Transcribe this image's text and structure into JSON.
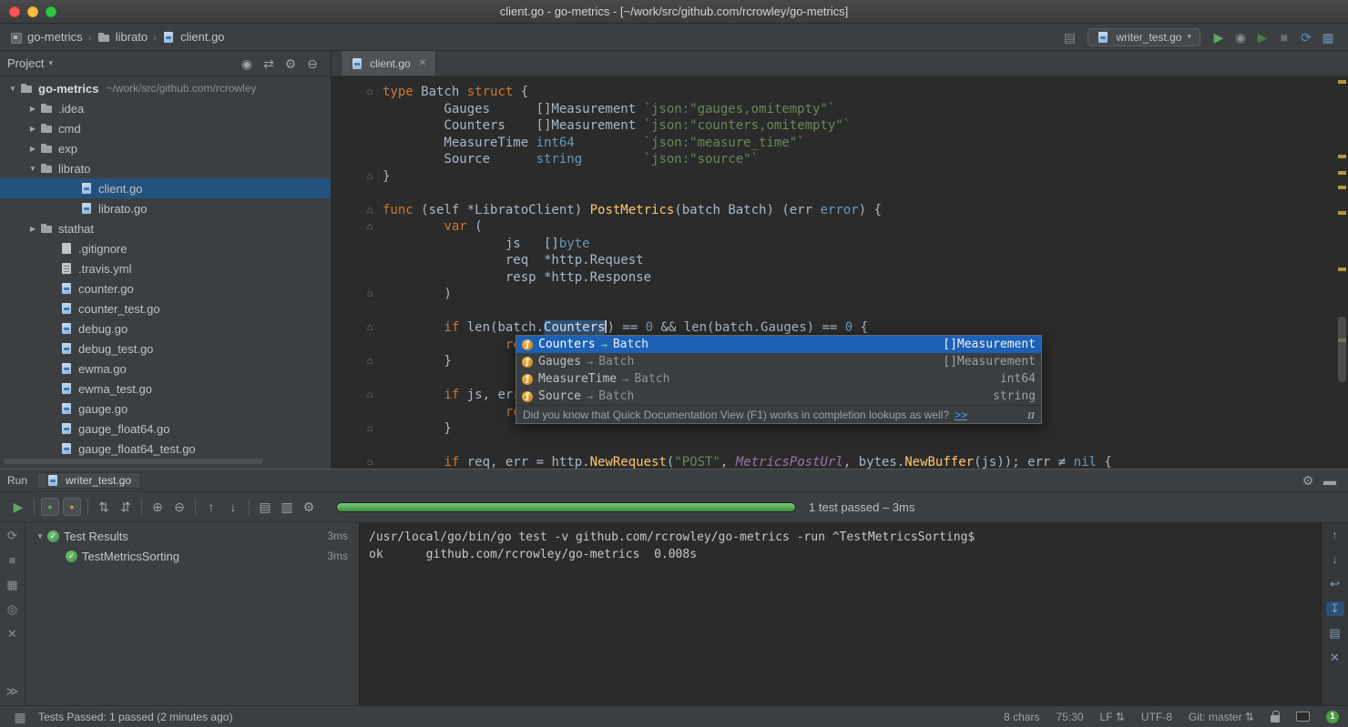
{
  "colors": {
    "panel_bg": "#3c3f41",
    "editor_bg": "#2b2b2b",
    "tree_selection": "#24527e",
    "completion_selection": "#1d61b5",
    "keyword_orange": "#cc7832",
    "string_green": "#6a8759",
    "type_blue": "#6897bb",
    "function_yellow": "#ffc66d",
    "run_green": "#5fa865",
    "progress_green": "#4f9f53",
    "warning_stripe": "#b89b3e"
  },
  "titlebar": {
    "title": "client.go - go-metrics - [~/work/src/github.com/rcrowley/go-metrics]"
  },
  "navbar": {
    "crumb_separator": "›",
    "breadcrumbs": [
      {
        "label": "go-metrics",
        "icon": "project"
      },
      {
        "label": "librato",
        "icon": "folder"
      },
      {
        "label": "client.go",
        "icon": "gofile"
      }
    ],
    "pre_actions": [
      {
        "n": "run-dashboard-icon",
        "g": "▤",
        "c": "#7f8b99"
      }
    ],
    "run_config": {
      "label": "writer_test.go",
      "chevron": "▾"
    },
    "actions": [
      {
        "n": "run-icon",
        "g": "▶",
        "c": "#5fa865"
      },
      {
        "n": "coverage-icon",
        "g": "◉",
        "c": "#8a8d8f"
      },
      {
        "n": "run-with-coverage-icon",
        "g": "▶",
        "c": "#49784d"
      },
      {
        "n": "stop-icon",
        "g": "■",
        "c": "#6b6e70"
      },
      {
        "n": "rerun-icon",
        "g": "⟳",
        "c": "#4e8fc4"
      },
      {
        "n": "editor-layout-icon",
        "g": "▦",
        "c": "#6c8cab"
      }
    ]
  },
  "project_panel": {
    "header": {
      "title": "Project",
      "chevron": "▾",
      "actions": [
        {
          "n": "locate-file-icon",
          "g": "◉",
          "c": "#9da2a8"
        },
        {
          "n": "scroll-from-source-icon",
          "g": "⇄",
          "c": "#9da2a8"
        },
        {
          "n": "settings-gear-icon",
          "g": "⚙",
          "c": "#9da2a8"
        },
        {
          "n": "collapse-all-icon",
          "g": "⊖",
          "c": "#9da2a8"
        }
      ]
    },
    "arrows": {
      "open": "▼",
      "closed": "▶"
    },
    "tree": [
      {
        "label": "go-metrics",
        "suffix": "~/work/src/github.com/rcrowley",
        "icon": "folder",
        "expand": "open",
        "indent": 0,
        "bold": true
      },
      {
        "label": ".idea",
        "icon": "folder",
        "expand": "closed",
        "indent": 1
      },
      {
        "label": "cmd",
        "icon": "folder",
        "expand": "closed",
        "indent": 1
      },
      {
        "label": "exp",
        "icon": "folder",
        "expand": "closed",
        "indent": 1
      },
      {
        "label": "librato",
        "icon": "folder",
        "expand": "open",
        "indent": 1
      },
      {
        "label": "client.go",
        "icon": "gofile",
        "indent": 3,
        "selected": true
      },
      {
        "label": "librato.go",
        "icon": "gofile",
        "indent": 3
      },
      {
        "label": "stathat",
        "icon": "folder",
        "expand": "closed",
        "indent": 1
      },
      {
        "label": ".gitignore",
        "icon": "file",
        "indent": 2
      },
      {
        "label": ".travis.yml",
        "icon": "yml",
        "indent": 2
      },
      {
        "label": "counter.go",
        "icon": "gofile",
        "indent": 2
      },
      {
        "label": "counter_test.go",
        "icon": "gofile",
        "indent": 2
      },
      {
        "label": "debug.go",
        "icon": "gofile",
        "indent": 2
      },
      {
        "label": "debug_test.go",
        "icon": "gofile",
        "indent": 2
      },
      {
        "label": "ewma.go",
        "icon": "gofile",
        "indent": 2
      },
      {
        "label": "ewma_test.go",
        "icon": "gofile",
        "indent": 2
      },
      {
        "label": "gauge.go",
        "icon": "gofile",
        "indent": 2
      },
      {
        "label": "gauge_float64.go",
        "icon": "gofile",
        "indent": 2
      },
      {
        "label": "gauge_float64_test.go",
        "icon": "gofile",
        "indent": 2
      }
    ]
  },
  "editor": {
    "tab": {
      "label": "client.go",
      "close_glyph": "✕"
    },
    "gutter_glyph": "⌂",
    "gutter_marks": [
      0,
      5,
      7,
      8,
      12,
      14,
      16,
      18,
      20,
      22
    ],
    "stripe_marks": [
      4,
      86,
      104,
      120,
      148,
      210,
      288
    ],
    "lines": [
      [
        [
          "k",
          "type"
        ],
        [
          "p",
          " Batch "
        ],
        [
          "k",
          "struct"
        ],
        [
          "p",
          " {"
        ]
      ],
      [
        [
          "p",
          "        Gauges      []Measurement "
        ],
        [
          "s",
          "`json:\"gauges,omitempty\"`"
        ]
      ],
      [
        [
          "p",
          "        Counters    []Measurement "
        ],
        [
          "s",
          "`json:\"counters,omitempty\"`"
        ]
      ],
      [
        [
          "p",
          "        MeasureTime "
        ],
        [
          "t",
          "int64"
        ],
        [
          "p",
          "         "
        ],
        [
          "s",
          "`json:\"measure_time\"`"
        ]
      ],
      [
        [
          "p",
          "        Source      "
        ],
        [
          "t",
          "string"
        ],
        [
          "p",
          "        "
        ],
        [
          "s",
          "`json:\"source\"`"
        ]
      ],
      [
        [
          "p",
          "}"
        ]
      ],
      [],
      [
        [
          "k",
          "func"
        ],
        [
          "p",
          " (self *LibratoClient) "
        ],
        [
          "f",
          "PostMetrics"
        ],
        [
          "p",
          "(batch Batch) (err "
        ],
        [
          "t",
          "error"
        ],
        [
          "p",
          ") {"
        ]
      ],
      [
        [
          "p",
          "        "
        ],
        [
          "k",
          "var"
        ],
        [
          "p",
          " ("
        ]
      ],
      [
        [
          "p",
          "                js   []"
        ],
        [
          "t",
          "byte"
        ]
      ],
      [
        [
          "p",
          "                req  *http.Request"
        ]
      ],
      [
        [
          "p",
          "                resp *http.Response"
        ]
      ],
      [
        [
          "p",
          "        )"
        ]
      ],
      [],
      [
        [
          "p",
          "        "
        ],
        [
          "k",
          "if"
        ],
        [
          "p",
          " len(batch."
        ],
        [
          "hl",
          "Counters"
        ],
        [
          "caret",
          ""
        ],
        [
          "p",
          ") == "
        ],
        [
          "n",
          "0"
        ],
        [
          "p",
          " && len(batch.Gauges) == "
        ],
        [
          "n",
          "0"
        ],
        [
          "p",
          " {"
        ]
      ],
      [
        [
          "p",
          "                "
        ],
        [
          "k",
          "re"
        ]
      ],
      [
        [
          "p",
          "        }"
        ]
      ],
      [],
      [
        [
          "p",
          "        "
        ],
        [
          "k",
          "if"
        ],
        [
          "p",
          " js, err"
        ]
      ],
      [
        [
          "p",
          "                "
        ],
        [
          "k",
          "re"
        ]
      ],
      [
        [
          "p",
          "        }"
        ]
      ],
      [],
      [
        [
          "p",
          "        "
        ],
        [
          "k",
          "if"
        ],
        [
          "p",
          " req, err = http."
        ],
        [
          "f",
          "NewRequest"
        ],
        [
          "p",
          "("
        ],
        [
          "s",
          "\"POST\""
        ],
        [
          "p",
          ", "
        ],
        [
          "i",
          "MetricsPostUrl"
        ],
        [
          "p",
          ", bytes."
        ],
        [
          "f",
          "NewBuffer"
        ],
        [
          "p",
          "(js)); err ≠ "
        ],
        [
          "t",
          "nil"
        ],
        [
          "p",
          " {"
        ]
      ]
    ],
    "completion": {
      "icon_glyph": "ƒ",
      "arrow": "→",
      "items": [
        {
          "name": "Counters",
          "target": "Batch",
          "type": "[]Measurement",
          "selected": true
        },
        {
          "name": "Gauges",
          "target": "Batch",
          "type": "[]Measurement"
        },
        {
          "name": "MeasureTime",
          "target": "Batch",
          "type": "int64"
        },
        {
          "name": "Source",
          "target": "Batch",
          "type": "string"
        }
      ],
      "hint": "Did you know that Quick Documentation View (F1) works in completion lookups as well?",
      "hint_link": ">>",
      "hint_pi": "π"
    }
  },
  "run_panel": {
    "label": "Run",
    "tab": "writer_test.go",
    "header_actions": [
      {
        "n": "settings-gear-icon",
        "g": "⚙",
        "c": "#9da2a8"
      },
      {
        "n": "hide-panel-icon",
        "g": "▬",
        "c": "#9da2a8"
      }
    ],
    "toolbar": [
      {
        "n": "rerun-tests-icon",
        "g": "▶",
        "c": "#5fa865"
      },
      {
        "sep": true
      },
      {
        "n": "show-passed-icon",
        "g": "●",
        "c": "#57a85c",
        "box": true
      },
      {
        "n": "show-ignored-icon",
        "g": "●",
        "c": "#b7a14a",
        "box": true
      },
      {
        "sep": true
      },
      {
        "n": "sort-alphabetically-icon",
        "g": "⇅",
        "c": "#9da2a8"
      },
      {
        "n": "sort-by-duration-icon",
        "g": "⇵",
        "c": "#9da2a8"
      },
      {
        "sep": true
      },
      {
        "n": "expand-all-icon",
        "g": "⊕",
        "c": "#9da2a8"
      },
      {
        "n": "collapse-all-icon",
        "g": "⊖",
        "c": "#9da2a8"
      },
      {
        "sep": true
      },
      {
        "n": "previous-failed-test-icon",
        "g": "↑",
        "c": "#9da2a8"
      },
      {
        "n": "next-failed-test-icon",
        "g": "↓",
        "c": "#9da2a8"
      },
      {
        "sep": true
      },
      {
        "n": "test-history-icon",
        "g": "▤",
        "c": "#9da2a8"
      },
      {
        "n": "import-results-icon",
        "g": "▥",
        "c": "#9da2a8"
      },
      {
        "n": "settings-gear-icon",
        "g": "⚙",
        "c": "#9da2a8"
      }
    ],
    "left_strip": [
      {
        "n": "rerun-icon",
        "g": "⟳",
        "c": "#8a9399"
      },
      {
        "n": "stop-icon",
        "g": "■",
        "c": "#6b6e70"
      },
      {
        "n": "restore-layout-icon",
        "g": "▦",
        "c": "#8a9399"
      },
      {
        "n": "pin-tab-icon",
        "g": "◎",
        "c": "#8a9399"
      },
      {
        "n": "close-icon",
        "g": "✕",
        "c": "#8a9399"
      },
      {
        "n": "more-tool-windows-icon",
        "g": "≫",
        "c": "#8a9399"
      }
    ],
    "right_strip": [
      {
        "n": "scroll-to-top-icon",
        "g": "↑",
        "c": "#8a9399"
      },
      {
        "n": "scroll-to-bottom-icon",
        "g": "↓",
        "c": "#8a9399"
      },
      {
        "n": "soft-wrap-icon",
        "g": "↩"
      },
      {
        "n": "scroll-to-end-icon",
        "g": "↧",
        "sel": true
      },
      {
        "n": "print-icon",
        "g": "▤"
      },
      {
        "n": "clear-console-icon",
        "g": "✕"
      }
    ],
    "progress_percent": 100,
    "progress_text": "1 test passed – 3ms",
    "pass_glyph": "✓",
    "tree": [
      {
        "label": "Test Results",
        "time": "3ms",
        "indent": 0,
        "expanded": true
      },
      {
        "label": "TestMetricsSorting",
        "time": "3ms",
        "indent": 1
      }
    ],
    "console": [
      "/usr/local/go/bin/go test -v github.com/rcrowley/go-metrics -run ^TestMetricsSorting$",
      "ok      github.com/rcrowley/go-metrics  0.008s"
    ]
  },
  "statusbar": {
    "left_icon": {
      "n": "toolwindow-toggle-icon",
      "g": "▦",
      "c": "#8a9399"
    },
    "left": "Tests Passed: 1 passed (2 minutes ago)",
    "arrow_glyph": "⇅",
    "items": [
      {
        "n": "selection-info",
        "t": "8 chars",
        "clickable": false
      },
      {
        "n": "caret-position",
        "t": "75:30"
      },
      {
        "n": "line-separator",
        "t": "LF",
        "arrows": true
      },
      {
        "n": "encoding",
        "t": "UTF-8"
      },
      {
        "n": "git-branch",
        "t": "Git: master",
        "arrows": true
      }
    ],
    "badge": "1"
  }
}
